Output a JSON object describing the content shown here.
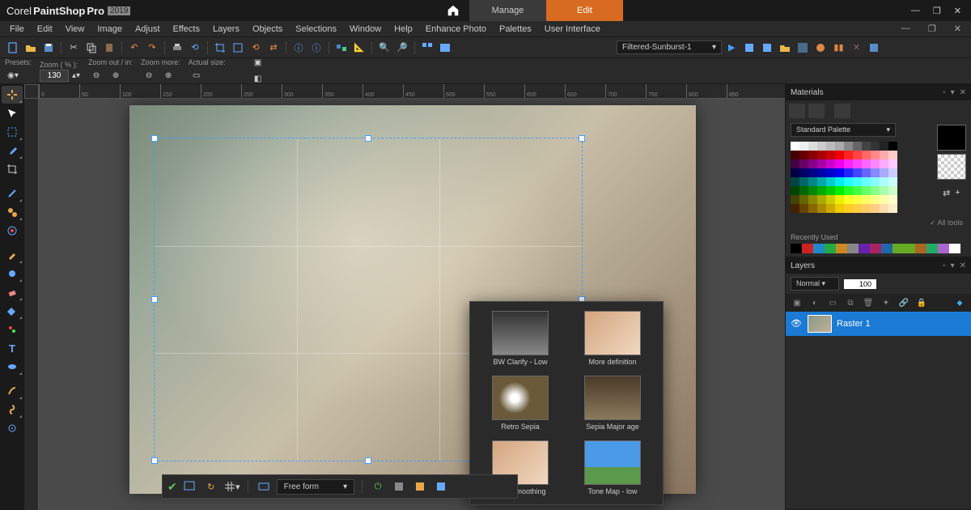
{
  "app": {
    "brand": "Corel",
    "name": "PaintShop",
    "suffix": "Pro",
    "year": "2019"
  },
  "modes": {
    "home": "⌂",
    "manage": "Manage",
    "edit": "Edit"
  },
  "menu": [
    "File",
    "Edit",
    "View",
    "Image",
    "Adjust",
    "Effects",
    "Layers",
    "Objects",
    "Selections",
    "Window",
    "Help",
    "Enhance Photo",
    "Palettes",
    "User Interface"
  ],
  "options": {
    "presets": "Presets:",
    "zoom_pct": "Zoom ( % ):",
    "zoom_value": "130",
    "zoom_out_in": "Zoom out / in:",
    "zoom_more": "Zoom more:",
    "actual": "Actual size:"
  },
  "effect_select": "Filtered-Sunburst-1",
  "effects": [
    {
      "label": "BW Clarify - Low",
      "cls": "bw"
    },
    {
      "label": "More definition",
      "cls": "smile"
    },
    {
      "label": "Retro Sepia",
      "cls": "flower"
    },
    {
      "label": "Sepia Major age",
      "cls": "sepia"
    },
    {
      "label": "Skin Smoothing",
      "cls": "smile"
    },
    {
      "label": "Tone Map - low",
      "cls": "sky"
    }
  ],
  "cropbar": {
    "mode": "Free form"
  },
  "materials": {
    "title": "Materials",
    "palette": "Standard Palette",
    "recent": "Recently Used",
    "alltools": "✓  All tools"
  },
  "layers": {
    "title": "Layers",
    "blend": "Normal",
    "opacity": "100",
    "name": "Raster 1"
  },
  "swatches_row1": [
    "#fff",
    "#eee",
    "#ddd",
    "#ccc",
    "#bbb",
    "#aaa",
    "#888",
    "#666",
    "#444",
    "#333",
    "#222",
    "#000"
  ],
  "swatches_colors": [
    "#400",
    "#600",
    "#800",
    "#a00",
    "#c00",
    "#e00",
    "#f22",
    "#f44",
    "#f66",
    "#f88",
    "#faa",
    "#fcc",
    "#404",
    "#606",
    "#808",
    "#a0a",
    "#c0c",
    "#e0e",
    "#f2f",
    "#f4f",
    "#f6f",
    "#f8f",
    "#faf",
    "#fcf",
    "#004",
    "#006",
    "#008",
    "#00a",
    "#00c",
    "#00e",
    "#22f",
    "#44f",
    "#66f",
    "#88f",
    "#aaf",
    "#ccf",
    "#044",
    "#066",
    "#088",
    "#0aa",
    "#0cc",
    "#0ee",
    "#2ff",
    "#4ff",
    "#6ff",
    "#8ff",
    "#aff",
    "#cff",
    "#040",
    "#060",
    "#080",
    "#0a0",
    "#0c0",
    "#0e0",
    "#2f2",
    "#4f4",
    "#6f6",
    "#8f8",
    "#afa",
    "#cfc",
    "#440",
    "#660",
    "#880",
    "#aa0",
    "#cc0",
    "#ee0",
    "#ff2",
    "#ff4",
    "#ff6",
    "#ff8",
    "#ffa",
    "#ffc",
    "#420",
    "#640",
    "#860",
    "#a80",
    "#ca0",
    "#ec0",
    "#fc2",
    "#fc4",
    "#fc6",
    "#fc8",
    "#fda",
    "#fec"
  ],
  "recent_colors": [
    "#000",
    "#c22",
    "#28c",
    "#2a4",
    "#c82",
    "#888",
    "#62a",
    "#a26",
    "#26a",
    "#6a2",
    "#6a2",
    "#a62",
    "#2a6",
    "#a6c",
    "#fff"
  ],
  "ruler_labels": [
    "0",
    "50",
    "100",
    "150",
    "200",
    "250",
    "300",
    "350",
    "400",
    "450",
    "500",
    "550",
    "600",
    "650",
    "700",
    "750",
    "800",
    "850"
  ]
}
